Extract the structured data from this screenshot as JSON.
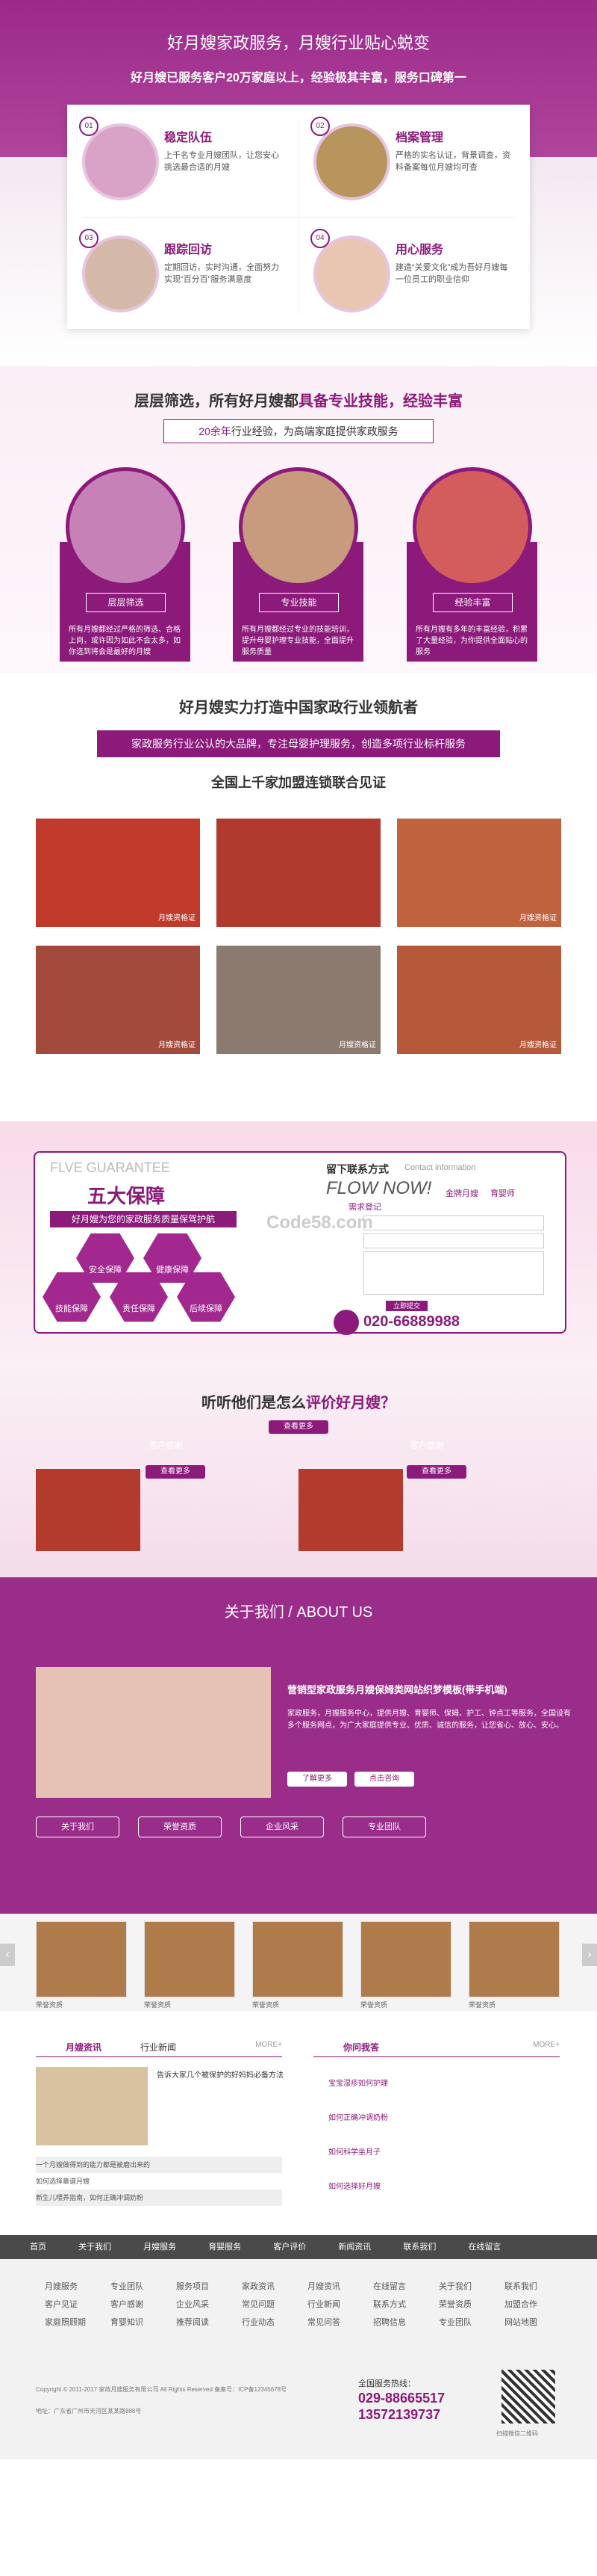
{
  "s1": {
    "title": "好月嫂家政服务，月嫂行业贴心蜕变",
    "subtitle": "好月嫂已服务客户20万家庭以上，经验极其丰富，服务口碑第一",
    "features": [
      {
        "num": "01",
        "title": "稳定队伍",
        "text": "上千名专业月嫂团队，让您安心挑选最合适的月嫂"
      },
      {
        "num": "02",
        "title": "档案管理",
        "text": "严格的实名认证，背景调查，资料备案每位月嫂均可查"
      },
      {
        "num": "03",
        "title": "跟踪回访",
        "text": "定期回访，实时沟通，全面努力实现“百分百”服务满意度"
      },
      {
        "num": "04",
        "title": "用心服务",
        "text": "建造“关爱文化”成为吾好月嫂每一位员工的职业信仰"
      }
    ]
  },
  "s2": {
    "title_a": "层层筛选，所有好月嫂都",
    "title_b": "具备专业技能，经验丰富",
    "bar_a": "20余年",
    "bar_b": "行业经验，为高端家庭提供家政服务",
    "cols": [
      {
        "label": "层层筛选",
        "text": "所有月嫂都经过严格的筛选、合格上岗，或许因为如此不会太多，如你选到将会是最好的月嫂"
      },
      {
        "label": "专业技能",
        "text": "所有月嫂都经过专业的技能培训，提升母婴护理专业技能，全面提升服务质量"
      },
      {
        "label": "经验丰富",
        "text": "所有月嫂有多年的丰富经验，积累了大量经验，为你提供全面贴心的服务"
      }
    ]
  },
  "s3": {
    "title": "好月嫂实力打造中国家政行业领航者",
    "band": "家政服务行业公认的大品牌，专注母婴护理服务，创造多项行业标杆服务",
    "subtitle": "全国上千家加盟连锁联合见证",
    "captions": [
      "月嫂资格证",
      "",
      "月嫂资格证",
      "月嫂资格证",
      "月嫂资格证",
      "月嫂资格证"
    ]
  },
  "s4": {
    "guarantee_en": "FLVE GUARANTEE",
    "guarantee": "五大保障",
    "guarantee_sub": "好月嫂为您的家政服务质量保驾护航",
    "hexes": [
      "安全保障",
      "健康保障",
      "技能保障",
      "责任保障",
      "后续保障"
    ],
    "contact_title": "留下联系方式",
    "contact_en": "Contact information",
    "flow": "FLOW NOW!",
    "flow_sub": "需求登记",
    "tags": [
      "金牌月嫂",
      "育婴师"
    ],
    "watermark": "Code58.com",
    "submit": "立即提交",
    "phone": "020-66889988"
  },
  "s5": {
    "title_a": "听听他们是怎么",
    "title_b": "评价好月嫂？",
    "btn_all": "查看更多",
    "card_a": "客户感谢",
    "card_b": "客户感谢",
    "btn_a": "查看更多",
    "btn_b": "查看更多"
  },
  "s6": {
    "title": "关于我们 / ABOUT US",
    "headline": "营销型家政服务月嫂保姆类网站织梦模板(带手机端)",
    "text": "家政服务，月嫂服务中心，提供月嫂、育婴师、保姆、护工、钟点工等服务，全国设有多个服务网点，为广大家庭提供专业、优质、诚信的服务，让您省心、放心、安心。",
    "btn1": "了解更多",
    "btn2": "点击咨询",
    "tabs": [
      "关于我们",
      "荣誉资质",
      "企业风采",
      "专业团队"
    ]
  },
  "s7": {
    "cert_labels": [
      "荣誉资质",
      "荣誉资质",
      "荣誉资质",
      "荣誉资质",
      "荣誉资质"
    ],
    "news_title": "月嫂资讯",
    "news_tab2": "行业新闻",
    "news_more": "MORE+",
    "news_head": "告诉大家几个被保护的好妈妈必备方法",
    "news_list": [
      "一个月嫂做得到的能力都是被磨出来的",
      "如何选择靠谱月嫂",
      "新生儿喂养指南，如何正确冲调奶粉"
    ],
    "qa_title": "你问我答",
    "qa_list": [
      "宝宝湿疹如何护理",
      "如何正确冲调奶粉",
      "如何科学坐月子",
      "如何选择好月嫂"
    ]
  },
  "footer": {
    "top_links": [
      "首页",
      "关于我们",
      "月嫂服务",
      "育婴服务",
      "客户评价",
      "新闻资讯",
      "联系我们",
      "在线留言"
    ],
    "cols": [
      [
        "月嫂服务",
        "客户见证",
        "家庭照顾期"
      ],
      [
        "专业团队",
        "客户感谢",
        "育婴知识"
      ],
      [
        "服务项目",
        "企业风采",
        "推荐阅读"
      ],
      [
        "家政资讯",
        "常见问题",
        "行业动态"
      ],
      [
        "月嫂资讯",
        "行业新闻",
        "常见问答"
      ],
      [
        "在线留言",
        "联系方式",
        "招聘信息"
      ],
      [
        "关于我们",
        "荣誉资质",
        "专业团队"
      ],
      [
        "联系我们",
        "加盟合作",
        "网站地图"
      ]
    ],
    "hotline_label": "全国服务热线：",
    "phone1": "029-88665517",
    "phone2": "13572139737",
    "copyright": "Copyright © 2011-2017 家政月嫂服务有限公司 All Rights Reserved 备案号：ICP备12345678号",
    "address": "地址：广东省广州市天河区某某路888号",
    "qr_label": "扫描微信二维码"
  },
  "colors": {
    "brand": "#8b1a7a",
    "brand_light": "#b0459c"
  }
}
